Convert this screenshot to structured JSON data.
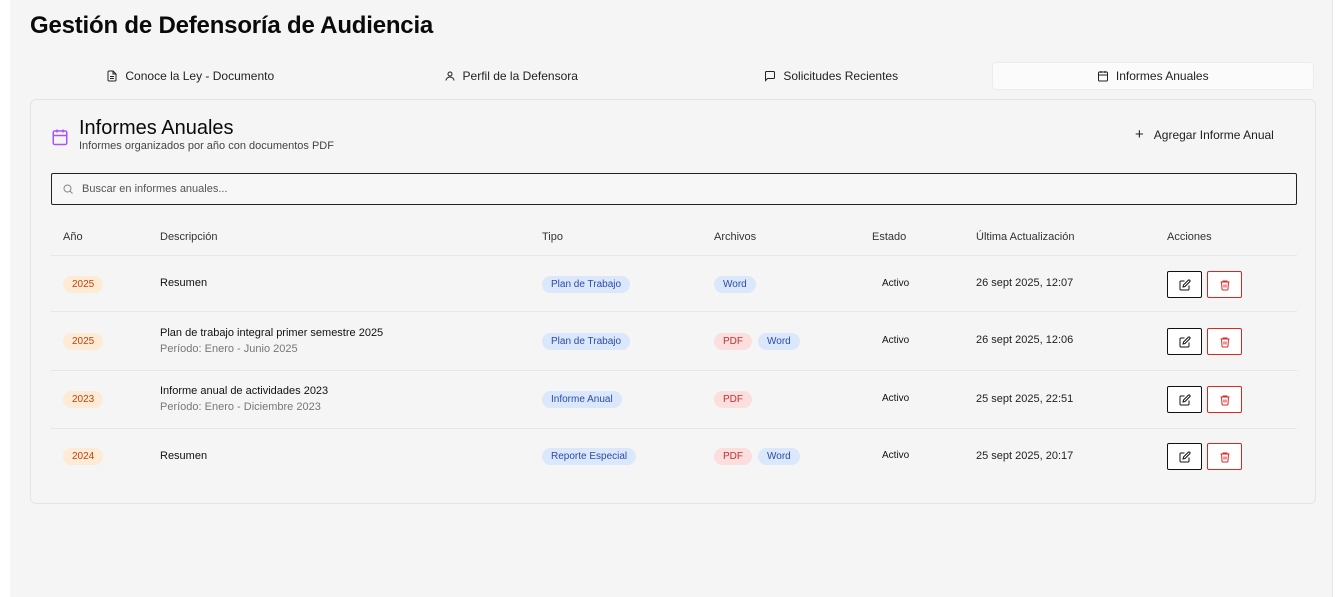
{
  "page_title": "Gestión de Defensoría de Audiencia",
  "tabs": [
    {
      "label": "Conoce la Ley - Documento",
      "icon": "document-icon"
    },
    {
      "label": "Perfil de la Defensora",
      "icon": "user-icon"
    },
    {
      "label": "Solicitudes Recientes",
      "icon": "message-icon"
    },
    {
      "label": "Informes Anuales",
      "icon": "calendar-icon",
      "active": true
    }
  ],
  "card": {
    "title": "Informes Anuales",
    "subtitle": "Informes organizados por año con documentos PDF",
    "add_label": "Agregar Informe Anual",
    "add_icon": "plus-icon",
    "title_icon": "calendar-icon",
    "accent": "#a855f7"
  },
  "search": {
    "placeholder": "Buscar en informes anuales..."
  },
  "table": {
    "headers": [
      "Año",
      "Descripción",
      "Tipo",
      "Archivos",
      "Estado",
      "Última Actualización",
      "Acciones"
    ],
    "rows": [
      {
        "year": "2025",
        "description": "Resumen",
        "subtitle": "",
        "type": "Plan de Trabajo",
        "files": [
          "Word"
        ],
        "status": "Activo",
        "updated": "26 sept 2025, 12:07"
      },
      {
        "year": "2025",
        "description": "Plan de trabajo integral primer semestre 2025",
        "subtitle": "Período: Enero - Junio 2025",
        "type": "Plan de Trabajo",
        "files": [
          "PDF",
          "Word"
        ],
        "status": "Activo",
        "updated": "26 sept 2025, 12:06"
      },
      {
        "year": "2023",
        "description": "Informe anual de actividades 2023",
        "subtitle": "Período: Enero - Diciembre 2023",
        "type": "Informe Anual",
        "files": [
          "PDF"
        ],
        "status": "Activo",
        "updated": "25 sept 2025, 22:51"
      },
      {
        "year": "2024",
        "description": "Resumen",
        "subtitle": "",
        "type": "Reporte Especial",
        "files": [
          "PDF",
          "Word"
        ],
        "status": "Activo",
        "updated": "25 sept 2025, 20:17"
      }
    ]
  },
  "colors": {
    "year_badge": "#fdebd6",
    "type_badge": "#dbe7fb",
    "pdf_badge": "#fbdede",
    "delete": "#dc2626"
  }
}
